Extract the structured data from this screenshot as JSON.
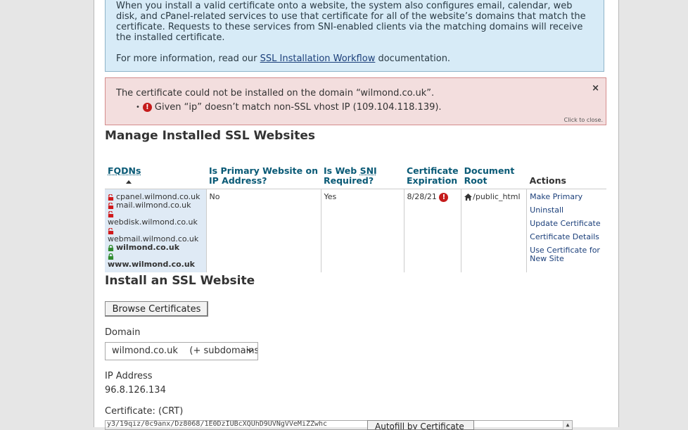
{
  "info": {
    "text": "When you install a valid certificate onto a website, the system also configures email, calendar, web disk, and cPanel-related services to use that certificate for all of the website’s domains that match the certificate. Requests to these services from SNI-enabled clients via the matching domains will receive the installed certificate.",
    "more_prefix": "For more information, read our ",
    "more_link": "SSL Installation Workflow",
    "more_suffix": " documentation."
  },
  "error": {
    "message": "The certificate could not be installed on the domain “wilmond.co.uk”.",
    "detail": "Given “ip” doesn’t match non-SSL vhost IP (109.104.118.139).",
    "close": "×",
    "click_to_close": "Click to close."
  },
  "manage": {
    "title": "Manage Installed SSL Websites",
    "headers": {
      "fqdns": "FQDNs",
      "primary": "Is Primary Website on IP Address?",
      "sni_prefix": "Is Web ",
      "sni_abbr": "SNI",
      "sni_suffix": " Required?",
      "expiration": "Certificate Expiration",
      "docroot": "Document Root",
      "actions": "Actions"
    },
    "row": {
      "fqdns": [
        {
          "name": "cpanel.wilmond.co.uk",
          "status": "red"
        },
        {
          "name": "mail.wilmond.co.uk",
          "status": "red"
        },
        {
          "name": "webdisk.wilmond.co.uk",
          "status": "red"
        },
        {
          "name": "webmail.wilmond.co.uk",
          "status": "red"
        },
        {
          "name": "wilmond.co.uk",
          "status": "green"
        },
        {
          "name": "www.wilmond.co.uk",
          "status": "green"
        }
      ],
      "primary": "No",
      "sni": "Yes",
      "expiration": "8/28/21",
      "docroot": "/public_html",
      "actions": [
        "Make Primary",
        "Uninstall",
        "Update Certificate",
        "Certificate Details",
        "Use Certificate for New Site"
      ]
    }
  },
  "install": {
    "title": "Install an SSL Website",
    "browse_button": "Browse Certificates",
    "domain_label": "Domain",
    "domain_value": "wilmond.co.uk    (+ subdomains)",
    "ip_label": "IP Address",
    "ip_value": "96.8.126.134",
    "crt_label": "Certificate: (CRT)",
    "crt_value": "y3/19qiz/0c9anx/Dz8068/1E0DzIUBcXQUhD9UVNgVVeMiZZwhc",
    "autofill_button": "Autofill by Certificate"
  },
  "colors": {
    "lock_red": "#d0191b",
    "lock_green": "#2e8b2e",
    "link": "#1b3f7a",
    "header": "#0a5a76"
  }
}
